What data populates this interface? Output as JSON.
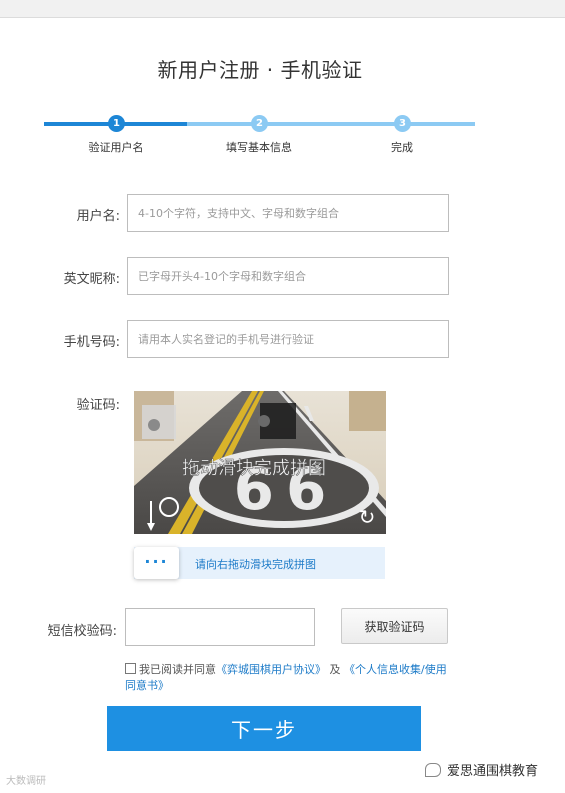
{
  "page": {
    "title": "新用户注册 · 手机验证"
  },
  "steps": [
    {
      "number": "1",
      "label": "验证用户名",
      "state": "active"
    },
    {
      "number": "2",
      "label": "填写基本信息",
      "state": "pending"
    },
    {
      "number": "3",
      "label": "完成",
      "state": "pending"
    }
  ],
  "form": {
    "username": {
      "label": "用户名:",
      "placeholder": "4-10个字符，支持中文、字母和数字组合",
      "value": ""
    },
    "nickname": {
      "label": "英文昵称:",
      "placeholder": "已字母开头4-10个字母和数字组合",
      "value": ""
    },
    "phone": {
      "label": "手机号码:",
      "placeholder": "请用本人实名登记的手机号进行验证",
      "value": ""
    },
    "captcha": {
      "label": "验证码:",
      "image_text": "拖动滑块完成拼图",
      "image_number": "66",
      "refresh_icon": "refresh-icon"
    },
    "slider": {
      "handle_text": "···",
      "hint": "请向右拖动滑块完成拼图"
    },
    "sms": {
      "label": "短信校验码:",
      "placeholder": "",
      "value": "",
      "button": "获取验证码"
    }
  },
  "agreement": {
    "checked": false,
    "prefix": "我已阅读并同意",
    "link1": "《弈城围棋用户协议》",
    "middle": "及",
    "link2": "《个人信息收集/使用同意书》"
  },
  "next_button": "下一步",
  "watermarks": {
    "left": "大数调研",
    "right": "爱思通围棋教育"
  },
  "colors": {
    "accent": "#1e90e2",
    "step_active": "#1d86d6",
    "step_inactive": "#8ccaf3",
    "slider_bg": "#e6f1fc"
  }
}
